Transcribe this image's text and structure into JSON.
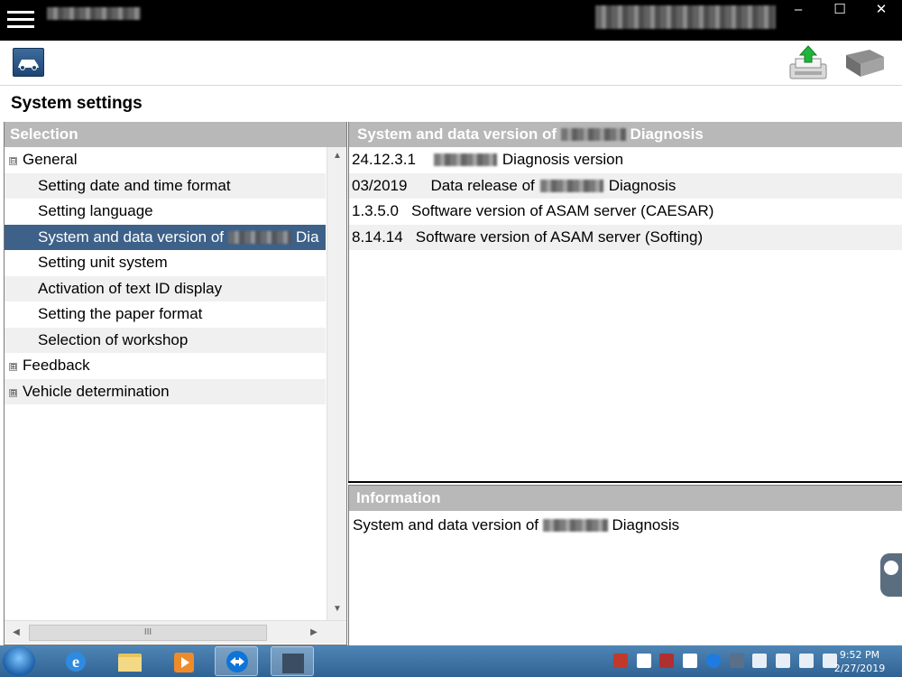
{
  "window": {
    "minimize": "–",
    "maximize": "☐",
    "close": "✕"
  },
  "page": {
    "title": "System settings"
  },
  "selection": {
    "header": "Selection",
    "tree": [
      {
        "label": "General",
        "expander": "⊟",
        "child": false
      },
      {
        "label": "Setting date and time format",
        "child": true
      },
      {
        "label": "Setting language",
        "child": true
      },
      {
        "label": "System and data version of",
        "suffix": "Dia",
        "child": true,
        "selected": true
      },
      {
        "label": "Setting unit system",
        "child": true
      },
      {
        "label": "Activation of text ID display",
        "child": true
      },
      {
        "label": "Setting the paper format",
        "child": true
      },
      {
        "label": "Selection of workshop",
        "child": true
      },
      {
        "label": "Feedback",
        "expander": "⊞",
        "child": false
      },
      {
        "label": "Vehicle determination",
        "expander": "⊞",
        "child": false
      }
    ],
    "scroll_up": "▲",
    "scroll_down": "▼",
    "scroll_left": "◀",
    "scroll_right": "▶",
    "hthumb_grip": "III"
  },
  "versions": {
    "header_prefix": "System and data version of",
    "header_suffix": "Diagnosis",
    "rows": [
      {
        "version": "24.12.3.1",
        "desc": "Diagnosis version"
      },
      {
        "version": "03/2019",
        "desc_prefix": "Data release of",
        "desc": "Diagnosis"
      },
      {
        "version": "1.3.5.0",
        "desc": "Software version of ASAM server (CAESAR)"
      },
      {
        "version": "8.14.14",
        "desc": "Software version of ASAM server (Softing)"
      }
    ]
  },
  "information": {
    "header": "Information",
    "text_prefix": "System and data version of",
    "text_suffix": "Diagnosis"
  },
  "taskbar": {
    "clock_time": "9:52 PM",
    "clock_date": "2/27/2019"
  },
  "colors": {
    "header_gray": "#b8b8b8",
    "selected_row": "#3d6188",
    "taskbar": "#3a73a5"
  }
}
